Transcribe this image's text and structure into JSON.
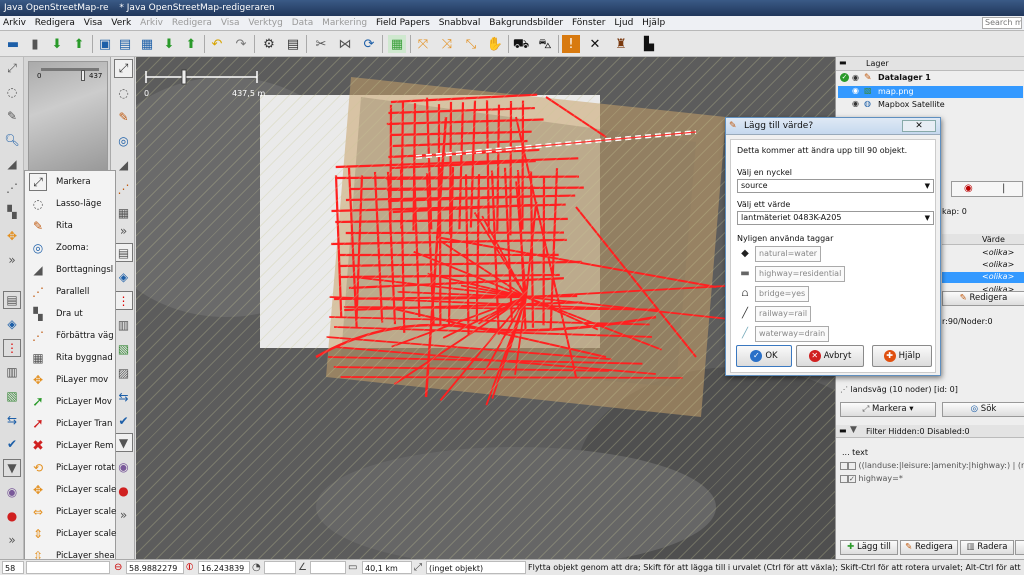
{
  "window": {
    "title_tabs": [
      "Java OpenStreetMap-re",
      "* Java OpenStreetMap-redigeraren"
    ]
  },
  "menu": {
    "items": [
      {
        "label": "Arkiv",
        "dim": false
      },
      {
        "label": "Redigera",
        "dim": false
      },
      {
        "label": "Visa",
        "dim": false
      },
      {
        "label": "Verk",
        "dim": false
      },
      {
        "label": "Arkiv",
        "dim": true
      },
      {
        "label": "Redigera",
        "dim": true
      },
      {
        "label": "Visa",
        "dim": true
      },
      {
        "label": "Verktyg",
        "dim": true
      },
      {
        "label": "Data",
        "dim": true
      },
      {
        "label": "Markering",
        "dim": true
      },
      {
        "label": "Field Papers",
        "dim": false
      },
      {
        "label": "Snabbval",
        "dim": false
      },
      {
        "label": "Bakgrundsbilder",
        "dim": false
      },
      {
        "label": "Fönster",
        "dim": false
      },
      {
        "label": "Ljud",
        "dim": false
      },
      {
        "label": "Hjälp",
        "dim": false
      }
    ],
    "search_placeholder": "Search me"
  },
  "minimap": {
    "scale_start": "0",
    "scale_end": "437"
  },
  "map": {
    "scale_start": "0",
    "scale_end": "437,5 m"
  },
  "mode_menu": {
    "items": [
      {
        "label": "Markera",
        "icon": "select-icon"
      },
      {
        "label": "Lasso-läge",
        "icon": "lasso-icon"
      },
      {
        "label": "Rita",
        "icon": "draw-icon"
      },
      {
        "label": "Zooma:",
        "icon": "zoom-icon"
      },
      {
        "label": "Borttagningsl",
        "icon": "delete-icon"
      },
      {
        "label": "Parallell",
        "icon": "parallel-icon"
      },
      {
        "label": "Dra ut",
        "icon": "extrude-icon"
      },
      {
        "label": "Förbättra väg",
        "icon": "improve-way-icon"
      },
      {
        "label": "Rita byggnad",
        "icon": "building-icon"
      },
      {
        "label": "PiLayer mov",
        "icon": "move-icon"
      },
      {
        "label": "PicLayer Mov",
        "icon": "arrow-icon"
      },
      {
        "label": "PicLayer Tran",
        "icon": "arrow-red-icon"
      },
      {
        "label": "PicLayer Rem",
        "icon": "remove-icon"
      },
      {
        "label": "PicLayer rotat",
        "icon": "rotate-icon"
      },
      {
        "label": "PicLayer scale",
        "icon": "scale-icon"
      },
      {
        "label": "PicLayer scale",
        "icon": "scale-x-icon"
      },
      {
        "label": "PicLayer scale",
        "icon": "scale-y-icon"
      },
      {
        "label": "PicLayer shea",
        "icon": "shear-icon"
      }
    ]
  },
  "layers": {
    "title": "Lager",
    "items": [
      {
        "label": "Datalager 1",
        "bold": true,
        "selected": false
      },
      {
        "label": "map.png",
        "bold": false,
        "selected": true
      },
      {
        "label": "Mapbox Satellite",
        "bold": false,
        "selected": false
      }
    ]
  },
  "dialog": {
    "title": "Lägg till värde?",
    "info": "Detta kommer att ändra upp till 90 objekt.",
    "key_label": "Välj en nyckel",
    "key_value": "source",
    "value_label": "Välj ett värde",
    "value_value": "lantmäteriet 0483K-A205",
    "recent_label": "Nyligen använda taggar",
    "recent_tags": [
      {
        "label": "natural=water",
        "icon": "water-icon"
      },
      {
        "label": "highway=residential",
        "icon": "road-icon"
      },
      {
        "label": "bridge=yes",
        "icon": "bridge-icon"
      },
      {
        "label": "railway=rail",
        "icon": "rail-icon"
      },
      {
        "label": "waterway=drain",
        "icon": "drain-icon"
      }
    ],
    "ok_label": "OK",
    "cancel_label": "Avbryt",
    "help_label": "Hjälp"
  },
  "tags_panel": {
    "fragment_a": "kap: 0",
    "col_value": "Värde",
    "values": [
      "<olika>",
      "<olika>",
      "<olika>",
      "<olika>"
    ],
    "edit_label": "Redigera",
    "relation_fragment": "r:90/Noder:0",
    "landsvag": "landsväg (10 noder) [id: 0]",
    "select_label": "Markera",
    "search_label": "Sök"
  },
  "filter": {
    "header": "Filter Hidden:0 Disabled:0",
    "row1": "... text",
    "row2": "((landuse:|leisure:|amenity:|highway:) | (role",
    "row3": "highway=*"
  },
  "bottom_buttons": {
    "add_label": "Lägg till",
    "edit_label": "Redigera",
    "delete_label": "Radera"
  },
  "status": {
    "left_val": "58",
    "lat": "58.9882279",
    "lon": "16.243839",
    "angle": "",
    "distance": "40,1 km",
    "object": "(inget objekt)",
    "help": "Flytta objekt genom att dra; Skift för att lägga till i urvalet (Ctrl för att växla); Skift-Ctrl för att rotera urvalet; Alt-Ctrl för att skala urvalet"
  },
  "colors": {
    "accent_blue": "#3399ff",
    "road_red": "#ff0000",
    "overlay_tan": "#c9a36a"
  }
}
